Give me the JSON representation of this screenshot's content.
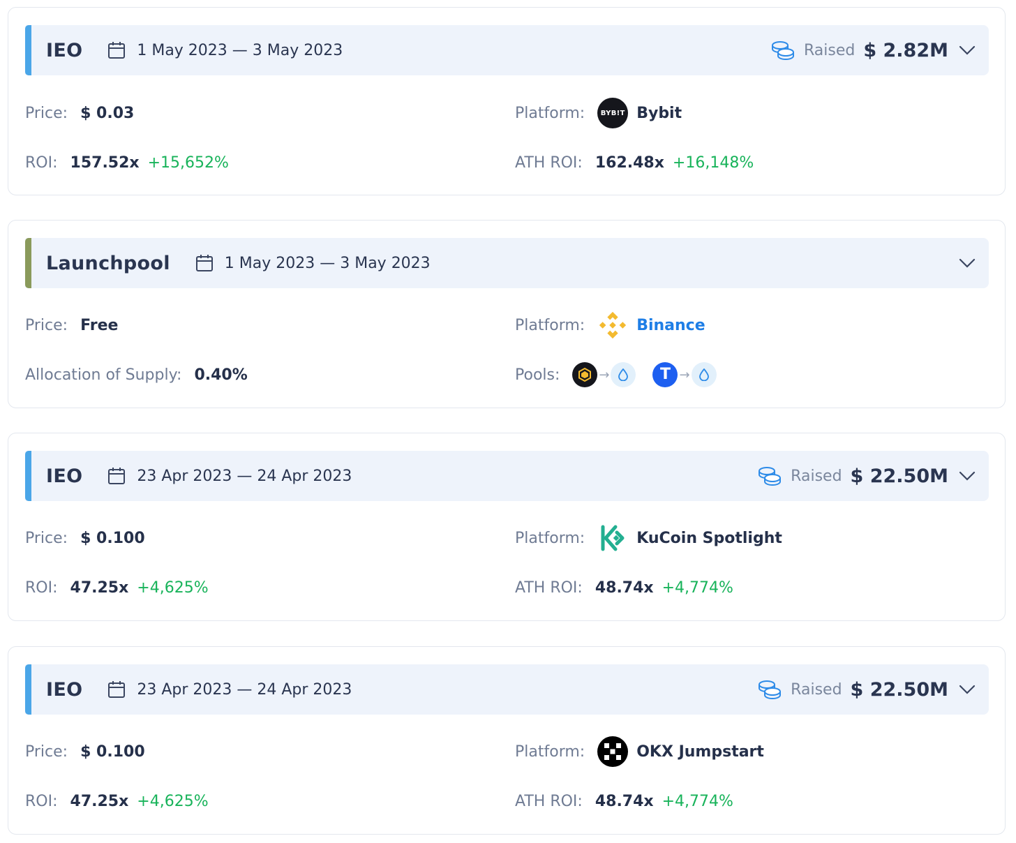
{
  "labels": {
    "price": "Price:",
    "roi": "ROI:",
    "ath_roi": "ATH ROI:",
    "platform": "Platform:",
    "allocation": "Allocation of Supply:",
    "pools": "Pools:",
    "raised": "Raised"
  },
  "colors": {
    "ieo_stripe": "#4aa6e8",
    "launchpool_stripe": "#8a9a5b",
    "positive": "#18b35a",
    "link": "#1e7ee6"
  },
  "cards": [
    {
      "type": "IEO",
      "dates": "1 May 2023 — 3 May 2023",
      "raised": "$ 2.82M",
      "price": "$ 0.03",
      "roi": "157.52x",
      "roi_pct": "+15,652%",
      "ath_roi": "162.48x",
      "ath_roi_pct": "+16,148%",
      "platform": "Bybit",
      "platform_logo_text": "BYB!T",
      "platform_icon": "bybit-logo-icon"
    },
    {
      "type": "Launchpool",
      "dates": "1 May 2023 — 3 May 2023",
      "price": "Free",
      "allocation": "0.40%",
      "platform": "Binance",
      "platform_icon": "binance-logo-icon",
      "pool_1_token_letter": "T"
    },
    {
      "type": "IEO",
      "dates": "23 Apr 2023 — 24 Apr 2023",
      "raised": "$ 22.50M",
      "price": "$ 0.100",
      "roi": "47.25x",
      "roi_pct": "+4,625%",
      "ath_roi": "48.74x",
      "ath_roi_pct": "+4,774%",
      "platform": "KuCoin Spotlight",
      "platform_icon": "kucoin-logo-icon"
    },
    {
      "type": "IEO",
      "dates": "23 Apr 2023 — 24 Apr 2023",
      "raised": "$ 22.50M",
      "price": "$ 0.100",
      "roi": "47.25x",
      "roi_pct": "+4,625%",
      "ath_roi": "48.74x",
      "ath_roi_pct": "+4,774%",
      "platform": "OKX Jumpstart",
      "platform_icon": "okx-logo-icon"
    }
  ]
}
